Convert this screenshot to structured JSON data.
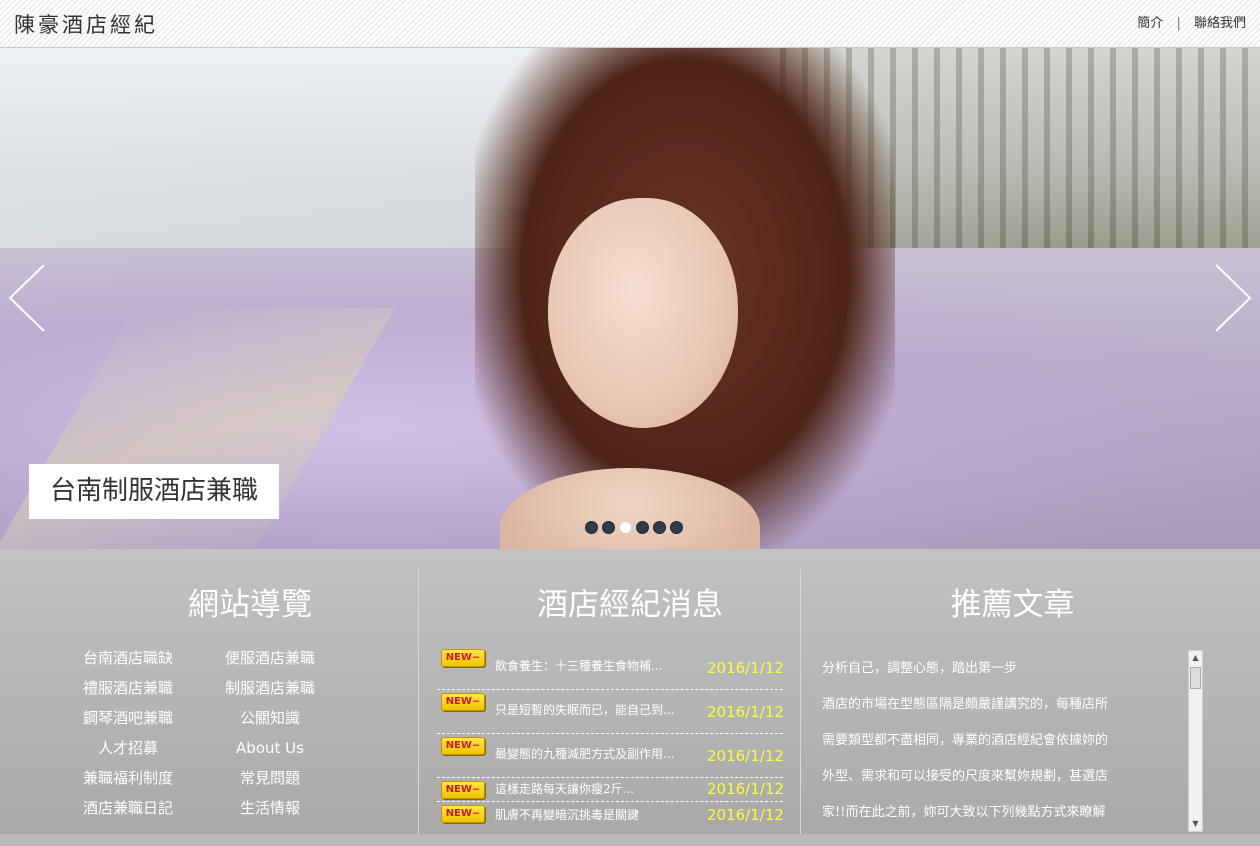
{
  "header": {
    "logo": "陳豪酒店經紀",
    "nav": [
      "簡介",
      "聯絡我們"
    ],
    "separator": "|"
  },
  "hero": {
    "caption": "台南制服酒店兼職",
    "slide_count": 6,
    "active_slide": 3,
    "prev_icon": "chevron-left-icon",
    "next_icon": "chevron-right-icon"
  },
  "sections": {
    "nav_title": "網站導覽",
    "news_title": "酒店經紀消息",
    "articles_title": "推薦文章"
  },
  "site_nav": {
    "left": [
      "台南酒店職缺",
      "禮服酒店兼職",
      "鋼琴酒吧兼職",
      "人才招募",
      "兼職福利制度",
      "酒店兼職日記"
    ],
    "right": [
      "便服酒店兼職",
      "制服酒店兼職",
      "公關知識",
      "About Us",
      "常見問題",
      "生活情報"
    ]
  },
  "news": {
    "badge": "NEW~",
    "items": [
      {
        "title": "飲食養生：十三種養生食物補...",
        "date": "2016/1/12"
      },
      {
        "title": "只是短暫的失眠而已，能自己到...",
        "date": "2016/1/12"
      },
      {
        "title": "最變態的九種減肥方式及副作用...",
        "date": "2016/1/12"
      },
      {
        "title": "這樣走路每天讓你瘦2斤...",
        "date": "2016/1/12"
      },
      {
        "title": "肌膚不再變暗沉挑毒是關鍵",
        "date": "2016/1/12"
      }
    ]
  },
  "article": {
    "heading": "分析自己，調整心態，踏出第一步",
    "lines": [
      "酒店的市場在型態區隔是頗嚴謹講究的，每種店所",
      "需要類型都不盡相同，專業的酒店經紀會依據妳的",
      "外型、需求和可以接受的尺度來幫妳規劃，甚選店",
      "家!!而在此之前，妳可大致以下列幾點方式來瞭解"
    ]
  },
  "colors": {
    "date": "#ffff33",
    "badge_bg": "#f0c400",
    "badge_text": "#d11b1b",
    "section_bg": "#b8b8b8"
  }
}
